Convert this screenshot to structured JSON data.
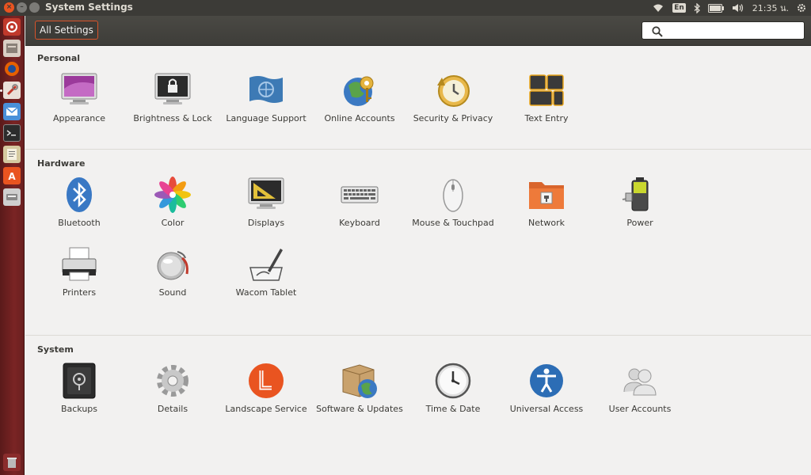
{
  "window": {
    "title": "System Settings"
  },
  "panel": {
    "lang": "En",
    "time": "21:35 น."
  },
  "toolbar": {
    "all_settings_label": "All Settings",
    "search_value": ""
  },
  "sections": {
    "personal": {
      "title": "Personal",
      "items": [
        {
          "label": "Appearance"
        },
        {
          "label": "Brightness & Lock"
        },
        {
          "label": "Language Support"
        },
        {
          "label": "Online Accounts"
        },
        {
          "label": "Security & Privacy"
        },
        {
          "label": "Text Entry"
        }
      ]
    },
    "hardware": {
      "title": "Hardware",
      "items": [
        {
          "label": "Bluetooth"
        },
        {
          "label": "Color"
        },
        {
          "label": "Displays"
        },
        {
          "label": "Keyboard"
        },
        {
          "label": "Mouse & Touchpad"
        },
        {
          "label": "Network"
        },
        {
          "label": "Power"
        },
        {
          "label": "Printers"
        },
        {
          "label": "Sound"
        },
        {
          "label": "Wacom Tablet"
        }
      ]
    },
    "system": {
      "title": "System",
      "items": [
        {
          "label": "Backups"
        },
        {
          "label": "Details"
        },
        {
          "label": "Landscape Service"
        },
        {
          "label": "Software & Updates"
        },
        {
          "label": "Time & Date"
        },
        {
          "label": "Universal Access"
        },
        {
          "label": "User Accounts"
        }
      ]
    }
  },
  "colors": {
    "accent": "#e95420",
    "panel_bg": "#3c3b37",
    "launcher_bg": "#7a2424",
    "content_bg": "#f2f1f0"
  }
}
